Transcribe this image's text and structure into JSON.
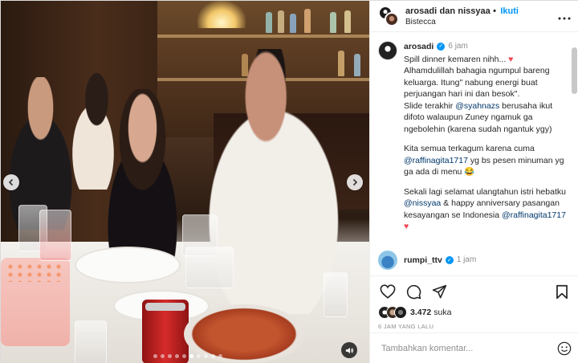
{
  "post_header": {
    "user1": "arosadi",
    "connector": "dan",
    "user2": "nissyaa",
    "separator": "•",
    "follow_label": "Ikuti",
    "location": "Bistecca",
    "more_icon": "more-horizontal-icon"
  },
  "caption": {
    "username": "arosadi",
    "time": "6 jam",
    "paragraphs": [
      {
        "before": "Spill dinner kemaren nihh... ",
        "emoji": "♥",
        "after": ""
      },
      {
        "text": "Alhamdulillah bahagia ngumpul bareng keluarga. Itung\" nabung energi buat perjuangan hari ini dan besok\"."
      },
      {
        "before": "Slide terakhir ",
        "mention": "@syahnazs",
        "after": " berusaha ikut difoto walaupun Zuney ngamuk ga ngebolehin (karena sudah ngantuk ygy)"
      }
    ],
    "para2_before": "Kita semua terkagum karena cuma ",
    "para2_mention": "@raffinagita1717",
    "para2_after": " yg bs pesen minuman yg ga ada di menu ",
    "para2_emoji": "😂",
    "para3_before": "Sekali lagi selamat ulangtahun istri hebatku ",
    "para3_mention": "@nissyaa",
    "para3_mid": " & happy anniversary pasangan kesayangan se Indonesia ",
    "para3_mention2": "@raffinagita1717",
    "para3_emoji": "♥"
  },
  "comment": {
    "username": "rumpi_ttv",
    "time": "1 jam"
  },
  "likes": {
    "count": "3.472",
    "label": "suka"
  },
  "timestamp": "6 JAM YANG LALU",
  "add_comment": {
    "placeholder": "Tambahkan komentar..."
  },
  "carousel": {
    "slides": 10,
    "active_index": 5
  },
  "colors": {
    "follow": "#0095f6",
    "verified": "#0095f6",
    "heart": "#ed4956",
    "mention": "#00376b"
  }
}
